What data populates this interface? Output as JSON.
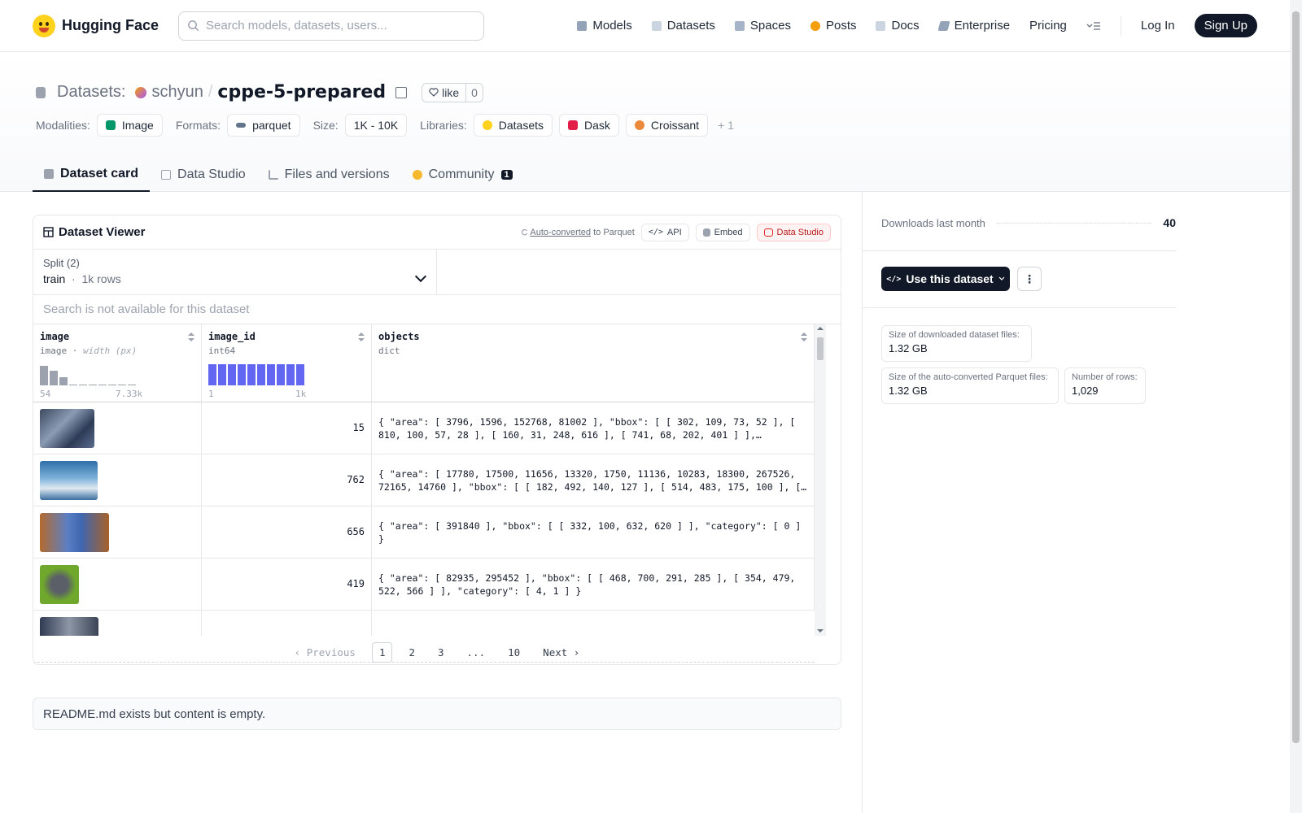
{
  "nav": {
    "brand": "Hugging Face",
    "search_placeholder": "Search models, datasets, users...",
    "links": [
      "Models",
      "Datasets",
      "Spaces",
      "Posts",
      "Docs",
      "Enterprise",
      "Pricing"
    ],
    "login": "Log In",
    "signup": "Sign Up"
  },
  "header": {
    "prefix": "Datasets:",
    "owner": "schyun",
    "sep": "/",
    "name": "cppe-5-prepared",
    "like_label": "like",
    "like_count": "0",
    "modalities_label": "Modalities:",
    "modality": "Image",
    "formats_label": "Formats:",
    "format": "parquet",
    "size_label": "Size:",
    "size": "1K - 10K",
    "libraries_label": "Libraries:",
    "libraries": [
      "Datasets",
      "Dask",
      "Croissant"
    ],
    "more_libraries": "+ 1"
  },
  "tabs": {
    "card": "Dataset card",
    "studio": "Data Studio",
    "files": "Files and versions",
    "community": "Community",
    "community_badge": "1"
  },
  "viewer": {
    "title": "Dataset Viewer",
    "autoconv_link": "Auto-converted",
    "autoconv_rest": "to Parquet",
    "api": "API",
    "embed": "Embed",
    "studio": "Data Studio",
    "split_label": "Split (2)",
    "split_value": "train",
    "split_rows": "1k rows",
    "search_na": "Search is not available for this dataset",
    "columns": {
      "image": {
        "name": "image",
        "type": "image",
        "subtype": "width (px)",
        "min": "54",
        "max": "7.33k"
      },
      "image_id": {
        "name": "image_id",
        "type": "int64",
        "min": "1",
        "max": "1k"
      },
      "objects": {
        "name": "objects",
        "type": "dict"
      }
    },
    "rows": [
      {
        "id": "15",
        "objects": "{ \"area\": [ 3796, 1596, 152768, 81002 ], \"bbox\": [ [ 302, 109, 73, 52 ], [\n810, 100, 57, 28 ], [ 160, 31, 248, 616 ], [ 741, 68, 202, 401 ] ],…"
      },
      {
        "id": "762",
        "objects": "{ \"area\": [ 17780, 17500, 11656, 13320, 1750, 11136, 10283, 18300, 267526,\n72165, 14760 ], \"bbox\": [ [ 182, 492, 140, 127 ], [ 514, 483, 175, 100 ], […"
      },
      {
        "id": "656",
        "objects": "{ \"area\": [ 391840 ], \"bbox\": [ [ 332, 100, 632, 620 ] ], \"category\": [ 0 ]\n}"
      },
      {
        "id": "419",
        "objects": "{ \"area\": [ 82935, 295452 ], \"bbox\": [ [ 468, 700, 291, 285 ], [ 354, 479,\n522, 566 ] ], \"category\": [ 4, 1 ] }"
      }
    ],
    "pager": {
      "prev": "Previous",
      "pages": [
        "1",
        "2",
        "3",
        "...",
        "10"
      ],
      "current": "1",
      "next": "Next"
    }
  },
  "readme": "README.md exists but content is empty.",
  "sidebar": {
    "downloads_label": "Downloads last month",
    "downloads_value": "40",
    "use_button": "Use this dataset",
    "stat1_label": "Size of downloaded dataset files:",
    "stat1_value": "1.32 GB",
    "stat2_label": "Size of the auto-converted Parquet files:",
    "stat2_value": "1.32 GB",
    "stat3_label": "Number of rows:",
    "stat3_value": "1,029"
  },
  "colors": {
    "accent": "#6366f1",
    "dark": "#111827",
    "red": "#b91c1c"
  }
}
